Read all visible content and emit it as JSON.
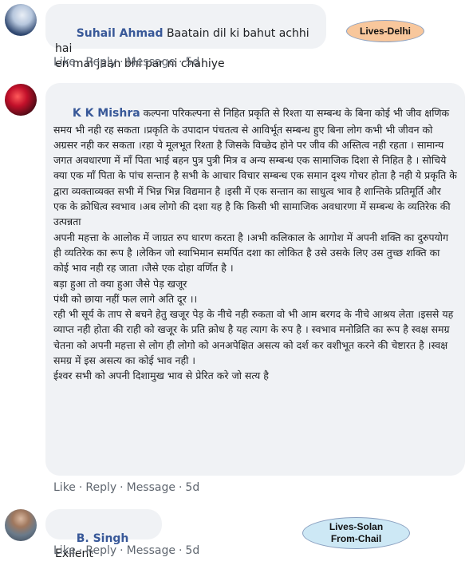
{
  "comments": [
    {
      "author": "Suhail Ahmad",
      "text": "Baatain dil ki bahut achhi hai\nen mai jaan bhi par ni chahiye",
      "actions": {
        "like": "Like",
        "reply": "Reply",
        "message": "Message",
        "time": "5d"
      }
    },
    {
      "author": "K K Mishra",
      "text": "कल्पना परिकल्पना से निहित प्रकृति से रिश्ता या सम्बन्ध के बिना कोई भी जीव क्षणिक समय भी नही रह सकता ।प्रकृति के उपादान पंचतत्व से आविर्भूत सम्बन्ध हुए बिना लोग कभी भी जीवन को अग्रसर नही कर सकता ।रहा ये मूलभूत रिश्ता है जिसके विच्छेद होने पर जीव की अस्तित्व नही रहता । सामान्य जगत अवधारणा में माँ पिता भाई बहन पुत्र पुत्री मित्र व अन्य सम्बन्ध एक सामाजिक दिशा से निहित है । सोचिये क्या एक माँ पिता के पांच सन्तान है सभी के आचार विचार सम्बन्ध एक समान दृश्य गोचर होता है नही ये प्रकृति के द्वारा व्यक्ताव्यक्त सभी में भिन्न भिन्न विद्यमान है ।इसी में एक सन्तान का साधुत्व भाव है शान्तिके प्रतिमूर्ति और एक के क्रोधित्व स्वभाव ।अब लोगो की दशा यह है कि किसी भी सामाजिक अवधारणा में सम्बन्ध के व्यतिरेक की उत्पन्नता\nअपनी महत्ता के आलोक में जाग्रत रुप धारण करता है ।अभी कलिकाल के आगोश में अपनी शक्ति का दुरुपयोग ही व्यतिरेक का रूप है ।लेकिन जो स्वाभिमान समर्पित दशा का लोकित है उसे उसके लिए उस तुच्छ शक्ति का कोई भाव नही रह जाता ।जैसे एक दोहा वर्णित है ।\nबड़ा हुआ तो क्या हुआ जैसे पेड़ खजूर\nपंथी को छाया नहीं फल लागे अति दूर ।।\nरही भी सूर्य के ताप से बचने हेतु खजूर पेड़ के नीचे नही रुकता वो भी आम बरगद के नीचे आश्रय लेता ।इससे यह व्याप्त नही होता की राही को खजूर के प्रति क्रोध है यह त्याग के रुप है । स्वभाव मनोव्रिति का रूप है स्वक्ष समग्र चेतना को अपनी महत्ता से लोग ही लोगो को अनअपेक्षित असत्य को दर्श कर वशीभूत करने की चेष्टारत है ।स्वक्ष समग्र में इस असत्य का कोई भाव नही ।\nईश्वर सभी को अपनी दिशामुख भाव से प्रेरित करे जो सत्य है",
      "actions": {
        "like": "Like",
        "reply": "Reply",
        "message": "Message",
        "time": "5d"
      }
    },
    {
      "author": "B. Singh",
      "text": "Exllent",
      "actions": {
        "like": "Like",
        "reply": "Reply",
        "message": "Message",
        "time": "5d"
      }
    }
  ],
  "badges": {
    "delhi": "Lives-Delhi",
    "solan_line1": "Lives-Solan",
    "solan_line2": "From-Chail"
  },
  "colors": {
    "author": "#385898",
    "bubble": "#f0f2f5",
    "actions": "#606770",
    "badge_fill": "#f8c79c",
    "badge_fill2": "#cde8f5"
  }
}
